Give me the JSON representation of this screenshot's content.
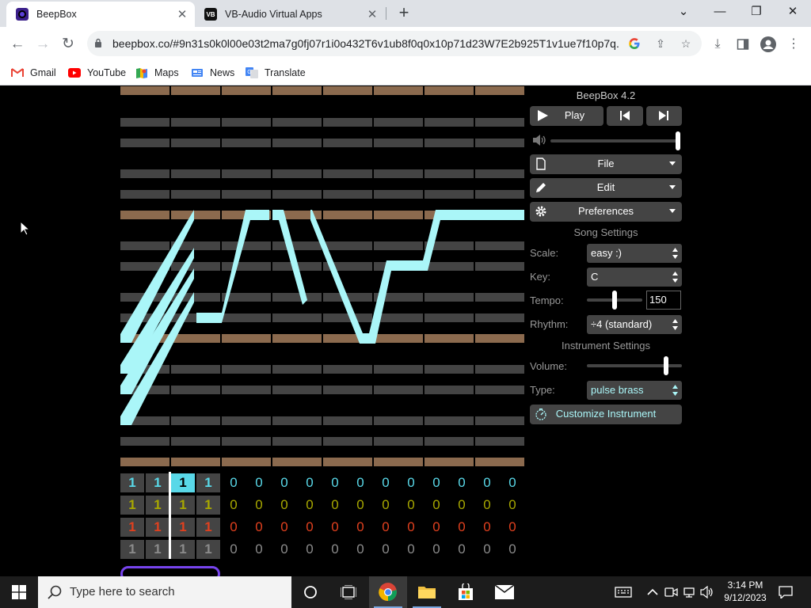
{
  "browser": {
    "tabs": [
      {
        "title": "BeepBox",
        "active": true
      },
      {
        "title": "VB-Audio Virtual Apps",
        "active": false
      }
    ],
    "new_tab": "+",
    "window_controls": {
      "chevron": "⌄",
      "minimize": "—",
      "restore": "❐",
      "close": "✕"
    },
    "url": "beepbox.co/#9n31s0k0l00e03t2ma7g0fj07r1i0o432T6v1ub8f0q0x10p71d23W7E2b925T1v1ue7f10p7q...",
    "bookmarks": [
      "Gmail",
      "YouTube",
      "Maps",
      "News",
      "Translate"
    ]
  },
  "app": {
    "title": "BeepBox 4.2",
    "play_label": "Play",
    "file_label": "File",
    "edit_label": "Edit",
    "preferences_label": "Preferences",
    "song_settings_label": "Song Settings",
    "scale_label": "Scale:",
    "scale_value": "easy :)",
    "key_label": "Key:",
    "key_value": "C",
    "tempo_label": "Tempo:",
    "tempo_value": "150",
    "rhythm_label": "Rhythm:",
    "rhythm_value": "÷4 (standard)",
    "instrument_settings_label": "Instrument Settings",
    "volume_label": "Volume:",
    "type_label": "Type:",
    "type_value": "pulse brass",
    "customize_label": "Customize Instrument",
    "master_volume_fraction": 1.0,
    "tempo_slider_fraction": 0.5,
    "instrument_volume_fraction": 0.85,
    "colors": {
      "note": "#aaf6f8",
      "cyan": "#59d8e8",
      "yellow": "#a8a800",
      "orange": "#e0401e",
      "gray": "#8b8b8b",
      "tonic_row": "#8b6a4e",
      "row": "#444444"
    },
    "track_rows": [
      {
        "color": "#59d8e8",
        "cells": [
          "1",
          "1",
          "1",
          "1",
          "0",
          "0",
          "0",
          "0",
          "0",
          "0",
          "0",
          "0",
          "0",
          "0",
          "0",
          "0"
        ]
      },
      {
        "color": "#a8a800",
        "cells": [
          "1",
          "1",
          "1",
          "1",
          "0",
          "0",
          "0",
          "0",
          "0",
          "0",
          "0",
          "0",
          "0",
          "0",
          "0",
          "0"
        ]
      },
      {
        "color": "#e0401e",
        "cells": [
          "1",
          "1",
          "1",
          "1",
          "0",
          "0",
          "0",
          "0",
          "0",
          "0",
          "0",
          "0",
          "0",
          "0",
          "0",
          "0"
        ]
      },
      {
        "color": "#8b8b8b",
        "cells": [
          "1",
          "1",
          "1",
          "1",
          "0",
          "0",
          "0",
          "0",
          "0",
          "0",
          "0",
          "0",
          "0",
          "0",
          "0",
          "0"
        ]
      }
    ]
  },
  "taskbar": {
    "search_placeholder": "Type here to search",
    "time": "3:14 PM",
    "date": "9/12/2023"
  }
}
